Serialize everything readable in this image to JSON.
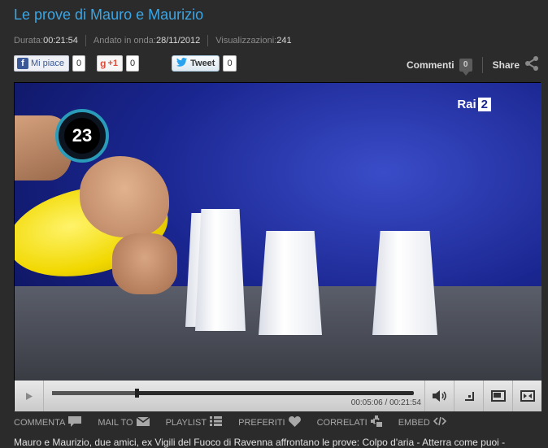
{
  "title": "Le prove di Mauro e Maurizio",
  "meta": {
    "duration_label": "Durata:",
    "duration_value": "00:21:54",
    "aired_label": "Andato in onda:",
    "aired_value": "28/11/2012",
    "views_label": "Visualizzazioni:",
    "views_value": "241"
  },
  "social": {
    "facebook_label": "Mi piace",
    "facebook_count": "0",
    "gplus_label": "+1",
    "gplus_count": "0",
    "twitter_label": "Tweet",
    "twitter_count": "0"
  },
  "header_actions": {
    "comments_label": "Commenti",
    "comments_count": "0",
    "share_label": "Share"
  },
  "video": {
    "timer_value": "23",
    "channel_logo_text": "Rai",
    "channel_logo_num": "2"
  },
  "player": {
    "time_current": "00:05:06",
    "time_separator": "/",
    "time_total": "00:21:54",
    "progress": 0.233
  },
  "actions": [
    {
      "label": "COMMENTA",
      "icon": "comment-icon"
    },
    {
      "label": "MAIL TO",
      "icon": "mail-icon"
    },
    {
      "label": "PLAYLIST",
      "icon": "playlist-icon"
    },
    {
      "label": "PREFERITI",
      "icon": "heart-icon"
    },
    {
      "label": "CORRELATI",
      "icon": "related-icon"
    },
    {
      "label": "EMBED",
      "icon": "embed-icon"
    }
  ],
  "description": "Mauro e Maurizio, due amici, ex Vigili del Fuoco di Ravenna affrontano le prove: Colpo d'aria - Atterra come puoi -"
}
